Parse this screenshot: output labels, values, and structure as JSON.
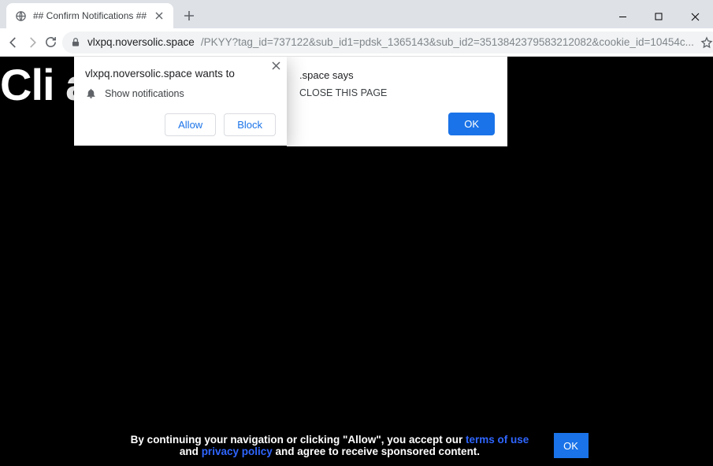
{
  "window": {
    "tab_title": "## Confirm Notifications ##"
  },
  "toolbar": {
    "url_host": "vlxpq.noversolic.space",
    "url_path": "/PKYY?tag_id=737122&sub_id1=pdsk_1365143&sub_id2=3513842379583212082&cookie_id=10454c..."
  },
  "page": {
    "headline": "Cli                                         at you are"
  },
  "alert": {
    "header_suffix": ".space says",
    "message_suffix": "CLOSE THIS PAGE",
    "ok": "OK"
  },
  "perm": {
    "header": "vlxpq.noversolic.space wants to",
    "line": "Show notifications",
    "allow": "Allow",
    "block": "Block"
  },
  "footer": {
    "t1": "By continuing your navigation or clicking \"Allow\", you accept our ",
    "terms": "terms of use",
    "and": " and ",
    "privacy": "privacy policy",
    "t2": " and agree to receive sponsored content.",
    "ok": "OK"
  }
}
